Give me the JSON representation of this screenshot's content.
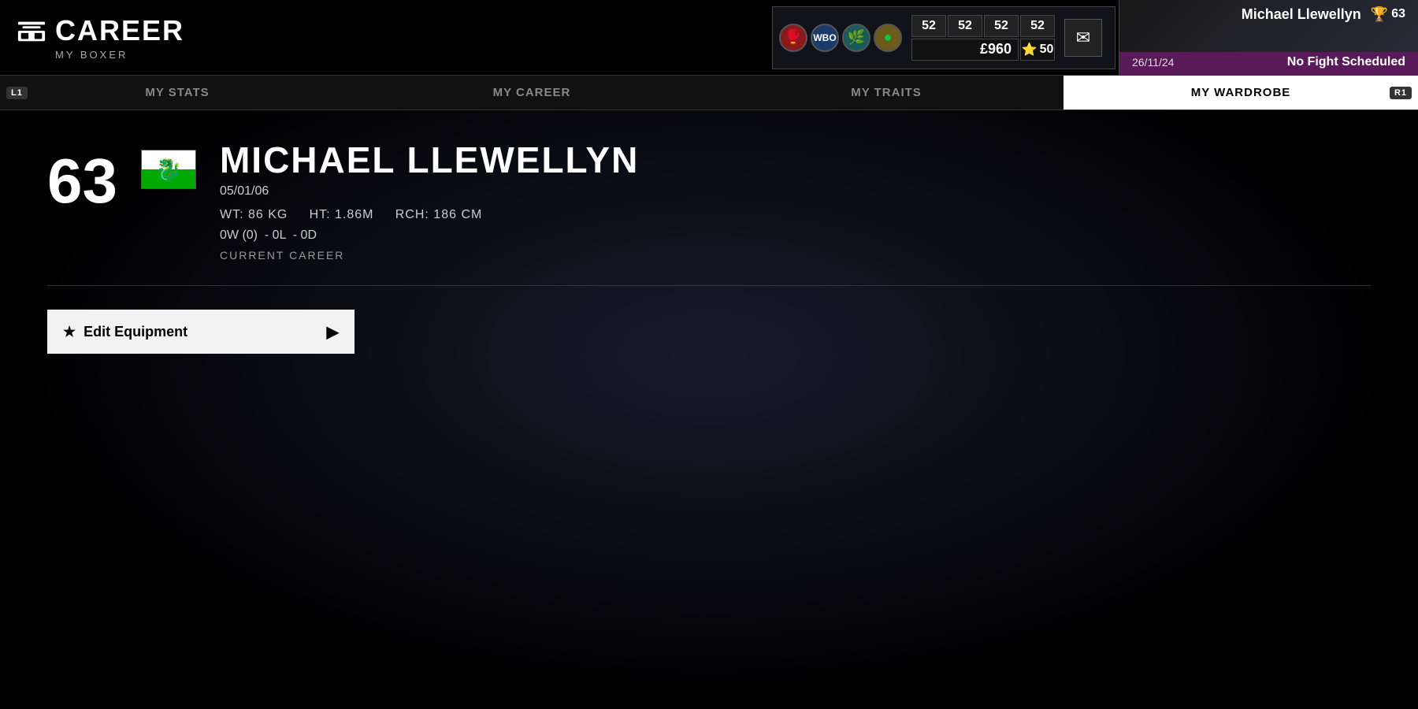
{
  "logo": {
    "title": "CAREER",
    "subtitle": "MY BOXER"
  },
  "hud": {
    "money": "£960",
    "stats": [
      "52",
      "52",
      "52",
      "52"
    ],
    "special_stat": "50",
    "mail_label": "✉"
  },
  "player": {
    "name": "Michael Llewellyn",
    "rating": "63",
    "date": "26/11/24",
    "fight_status": "No Fight Scheduled"
  },
  "nav": {
    "tabs": [
      {
        "id": "my-stats",
        "label": "My Stats",
        "left_btn": "L1"
      },
      {
        "id": "my-career",
        "label": "My Career"
      },
      {
        "id": "my-traits",
        "label": "My Traits"
      },
      {
        "id": "my-wardrobe",
        "label": "My Wardrobe",
        "active": true,
        "right_btn": "R1"
      }
    ]
  },
  "boxer": {
    "rating": "63",
    "name": "MICHAEL LLEWELLYN",
    "dob": "05/01/06",
    "weight": "86 KG",
    "height": "1.86M",
    "reach": "186 CM",
    "wins": "0",
    "win_details": "(0)",
    "losses": "0",
    "draws": "0",
    "career_label": "CURRENT CAREER"
  },
  "wardrobe": {
    "edit_equipment_label": "Edit Equipment",
    "star": "★",
    "arrow": "▶"
  }
}
